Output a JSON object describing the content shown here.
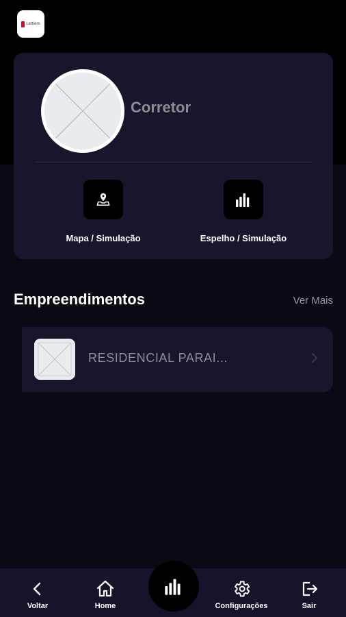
{
  "app": {
    "logo_text": "Lettiers",
    "logo_color": "#c8102e"
  },
  "profile": {
    "name": "Corretor"
  },
  "actions": [
    {
      "label": "Mapa / Simulação",
      "icon": "map-pin-icon"
    },
    {
      "label": "Espelho / Simulação",
      "icon": "bar-chart-icon"
    }
  ],
  "section": {
    "title": "Empreendimentos",
    "see_more": "Ver Mais"
  },
  "enterprises": [
    {
      "name": "RESIDENCIAL PARAI...",
      "icon": "image-placeholder-icon"
    }
  ],
  "nav": {
    "back": "Voltar",
    "home": "Home",
    "center_icon": "bar-chart-icon",
    "settings": "Configurações",
    "exit": "Sair"
  },
  "colors": {
    "background": "#0b0914",
    "card": "#18152c",
    "nav": "#16132b",
    "muted_text": "#8e8d96"
  }
}
